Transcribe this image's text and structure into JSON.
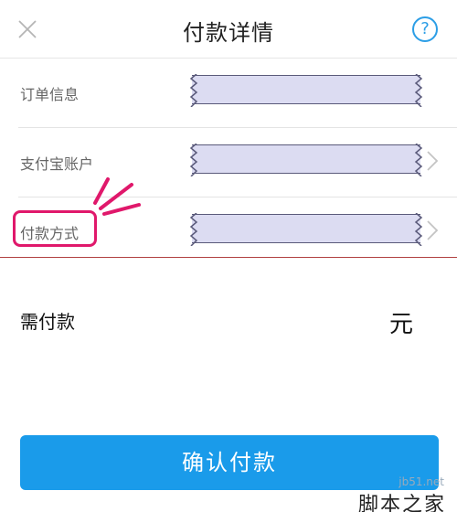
{
  "header": {
    "title": "付款详情",
    "help_label": "?"
  },
  "rows": [
    {
      "label": "订单信息"
    },
    {
      "label": "支付宝账户"
    },
    {
      "label": "付款方式"
    }
  ],
  "amount": {
    "label": "需付款",
    "unit": "元"
  },
  "confirm": {
    "label": "确认付款"
  },
  "watermark": {
    "site": "jb51.net",
    "name": "脚本之家"
  },
  "colors": {
    "accent": "#1a9bea",
    "highlight": "#e0186b",
    "redacted": "#dcdcf2"
  }
}
